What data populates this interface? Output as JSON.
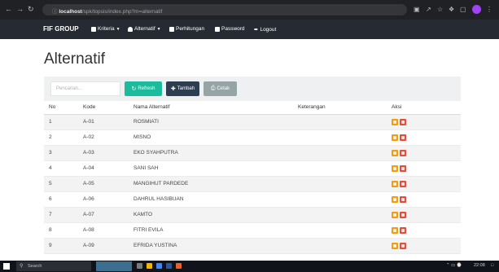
{
  "browser": {
    "back_icon": "arrow-left-icon",
    "forward_icon": "arrow-right-icon",
    "reload_icon": "reload-icon",
    "url_host": "localhost",
    "url_path": "/spk/topsis/index.php?m=alternatif"
  },
  "navbar": {
    "brand": "FIF GROUP",
    "items": [
      {
        "label": "Kriteria",
        "icon": "grid-icon",
        "has_dropdown": true
      },
      {
        "label": "Alternatif",
        "icon": "person-icon",
        "has_dropdown": true
      },
      {
        "label": "Perhitungan",
        "icon": "list-icon",
        "has_dropdown": false
      },
      {
        "label": "Password",
        "icon": "lock-icon",
        "has_dropdown": false
      },
      {
        "label": "Logout",
        "icon": "logout-icon",
        "has_dropdown": false
      }
    ],
    "background": "#262a33"
  },
  "page": {
    "title": "Alternatif"
  },
  "toolbar": {
    "search_placeholder": "Pencarian...",
    "refresh_label": "Refresh",
    "tambah_label": "Tambah",
    "cetak_label": "Cetak",
    "refresh_color": "#1abc9c",
    "tambah_color": "#2c3e50",
    "cetak_color": "#95a5a6"
  },
  "table": {
    "headers": [
      "No",
      "Kode",
      "Nama Alternatif",
      "Keterangan",
      "Aksi"
    ],
    "rows": [
      {
        "no": "1",
        "kode": "A-01",
        "nama": "ROSMIATI",
        "keterangan": ""
      },
      {
        "no": "2",
        "kode": "A-02",
        "nama": "MISNO",
        "keterangan": ""
      },
      {
        "no": "3",
        "kode": "A-03",
        "nama": "EKO SYAHPUTRA",
        "keterangan": ""
      },
      {
        "no": "4",
        "kode": "A-04",
        "nama": "SANI SAH",
        "keterangan": ""
      },
      {
        "no": "5",
        "kode": "A-05",
        "nama": "MANGIHUT PARDEDE",
        "keterangan": ""
      },
      {
        "no": "6",
        "kode": "A-06",
        "nama": "DAHRUL HASIBUAN",
        "keterangan": ""
      },
      {
        "no": "7",
        "kode": "A-07",
        "nama": "KAMTO",
        "keterangan": ""
      },
      {
        "no": "8",
        "kode": "A-08",
        "nama": "FITRI EVILA",
        "keterangan": ""
      },
      {
        "no": "9",
        "kode": "A-09",
        "nama": "EFRIDA YUSTINA",
        "keterangan": ""
      }
    ],
    "edit_color": "#f39c12",
    "delete_color": "#e74c3c"
  },
  "taskbar": {
    "search_label": "Search",
    "clock": "22:08"
  }
}
